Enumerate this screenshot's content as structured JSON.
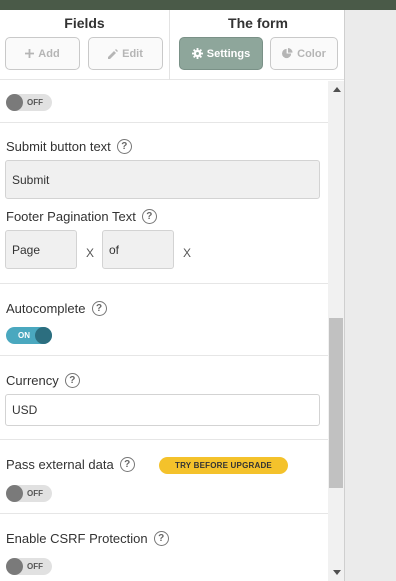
{
  "header": {
    "fields_title": "Fields",
    "form_title": "The form",
    "add_label": "Add",
    "edit_label": "Edit",
    "settings_label": "Settings",
    "color_label": "Color"
  },
  "settings": {
    "top_toggle": {
      "state": "OFF"
    },
    "submit_button_text": {
      "label": "Submit button text",
      "help": "?",
      "value": "Submit"
    },
    "footer_pagination": {
      "label": "Footer Pagination Text",
      "help": "?",
      "value_1": "Page",
      "value_2": "of",
      "separator": "X"
    },
    "autocomplete": {
      "label": "Autocomplete",
      "help": "?",
      "state": "ON"
    },
    "currency": {
      "label": "Currency",
      "help": "?",
      "value": "USD"
    },
    "pass_external_data": {
      "label": "Pass external data",
      "help": "?",
      "badge": "TRY BEFORE UPGRADE",
      "state": "OFF"
    },
    "csrf": {
      "label": "Enable CSRF Protection",
      "help": "?",
      "state": "OFF"
    }
  },
  "colors": {
    "active_button": "#8ea69b",
    "toggle_on": "#4aa8bf",
    "badge": "#f4c22b"
  }
}
